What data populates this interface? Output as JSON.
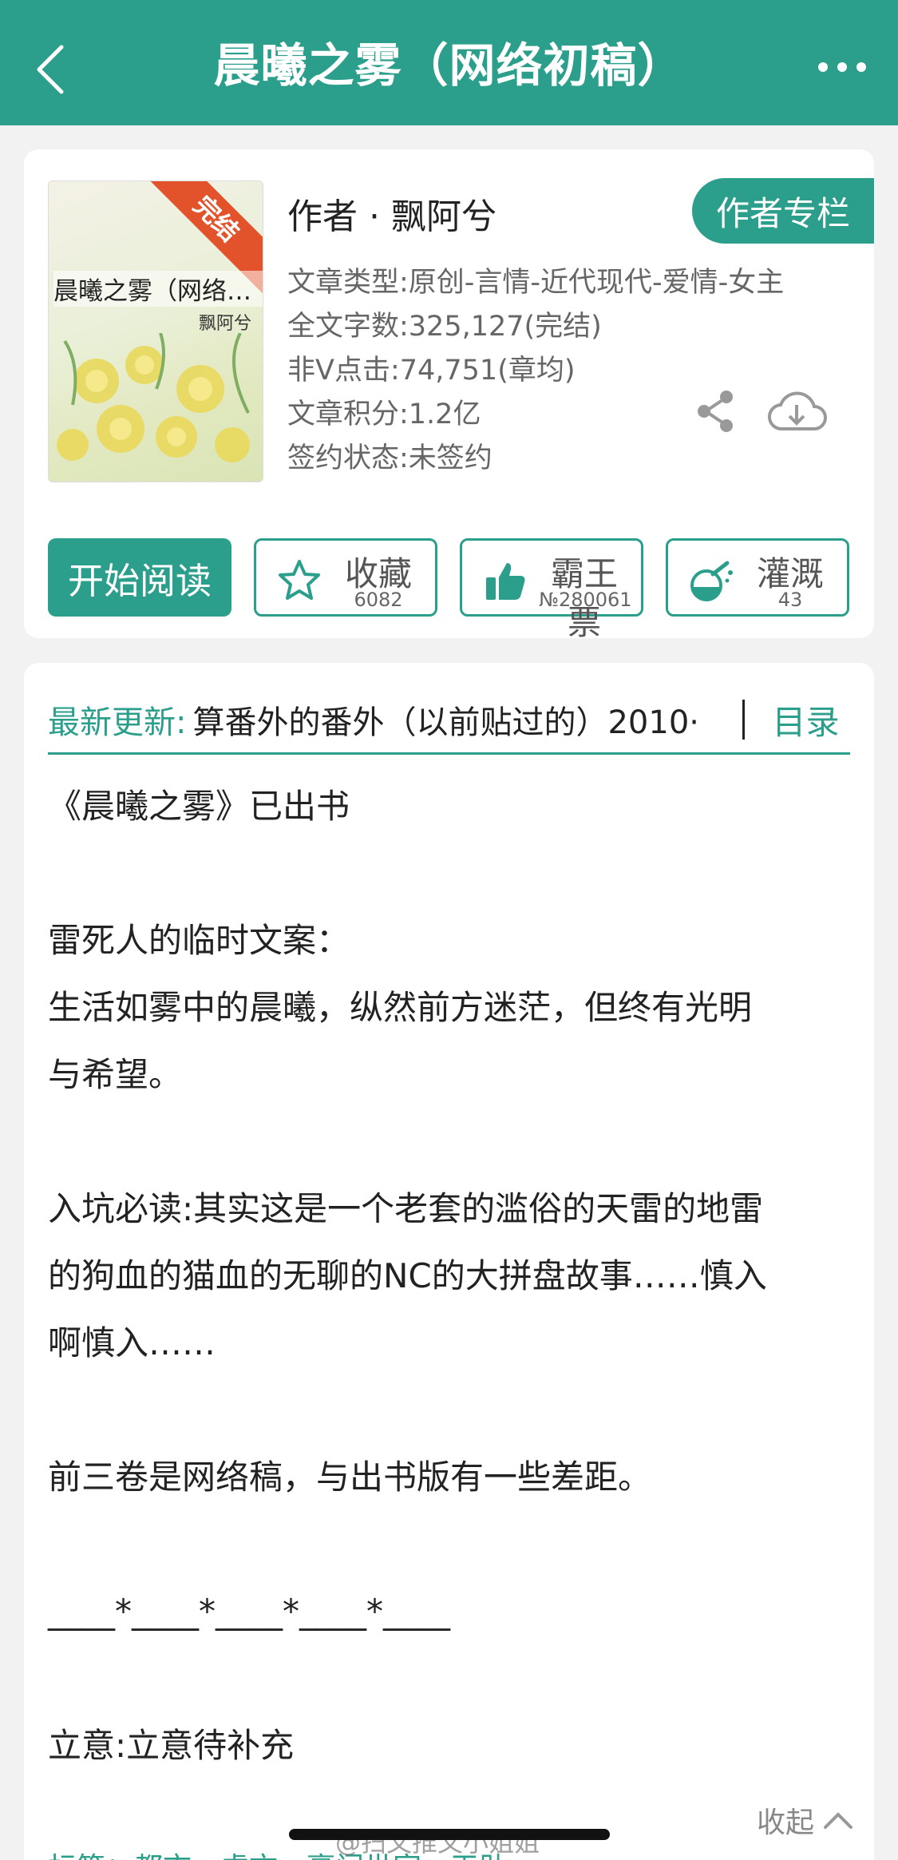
{
  "header": {
    "title": "晨曦之雾（网络初稿）",
    "back_icon": "back-arrow-icon",
    "more_icon": "more-dots-icon"
  },
  "book": {
    "cover_badge": "完结",
    "cover_title": "晨曦之雾（网络初稿）",
    "cover_author": "飘阿兮",
    "author_line": "作者 · 飘阿兮",
    "author_column_button": "作者专栏",
    "meta": [
      "文章类型:原创-言情-近代现代-爱情-女主",
      "全文字数:325,127(完结)",
      "非V点击:74,751(章均)",
      "文章积分:1.2亿",
      "签约状态:未签约"
    ]
  },
  "actions": {
    "read": "开始阅读",
    "favorite": {
      "label": "收藏",
      "count": "6082"
    },
    "vote": {
      "label": "霸王票",
      "count": "№280061"
    },
    "water": {
      "label": "灌溉",
      "count": "43"
    }
  },
  "update": {
    "label": "最新更新:",
    "text": "算番外的番外（以前贴过的）2010·",
    "toc": "目录"
  },
  "description": [
    "《晨曦之雾》已出书",
    "",
    "雷死人的临时文案：",
    "生活如雾中的晨曦，纵然前方迷茫，但终有光明",
    "与希望。",
    "",
    "入坑必读:其实这是一个老套的滥俗的天雷的地雷",
    "的狗血的猫血的无聊的NC的大拼盘故事……慎入",
    "啊慎入……",
    "",
    "前三卷是网络稿，与出书版有一些差距。",
    "",
    "____*____*____*____*____",
    "",
    "立意:立意待补充"
  ],
  "collapse": "收起",
  "tags": "标签：都市　虐文　豪门世家　天助",
  "watermark": "@扫文推文小姐姐",
  "colors": {
    "accent": "#2b9f8b",
    "badge": "#e2532b"
  }
}
